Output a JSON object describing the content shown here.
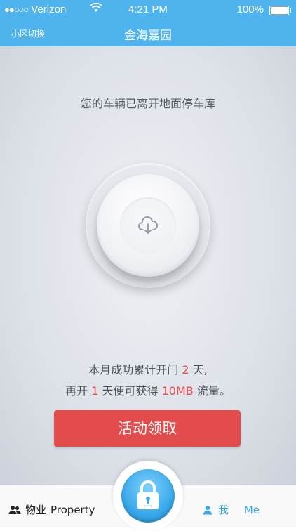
{
  "status_bar": {
    "carrier": "Verizon",
    "time": "4:21 PM",
    "battery": "100%"
  },
  "nav": {
    "switch_label": "小区切换",
    "title": "金海嘉园"
  },
  "main": {
    "message": "您的车辆已离开地面停车库",
    "stats_line1_prefix": "本月成功累计开门",
    "stats_days": "2",
    "stats_line1_suffix": "天,",
    "stats_line2_prefix": "再开",
    "stats_more_days": "1",
    "stats_line2_mid": "天便可获得",
    "stats_data": "10MB",
    "stats_line2_suffix": "流量。",
    "activity_button": "活动领取"
  },
  "tabbar": {
    "property_cn": "物业",
    "property_en": "Property",
    "me_cn": "我",
    "me_en": "Me"
  },
  "icons": {
    "center_button": "cloud-download-icon",
    "lock": "lock-icon",
    "property": "people-icon",
    "me": "person-icon"
  },
  "colors": {
    "brand_blue": "#4fb3ee",
    "accent_red": "#e24c4c",
    "highlight_red": "#e34b4e"
  }
}
